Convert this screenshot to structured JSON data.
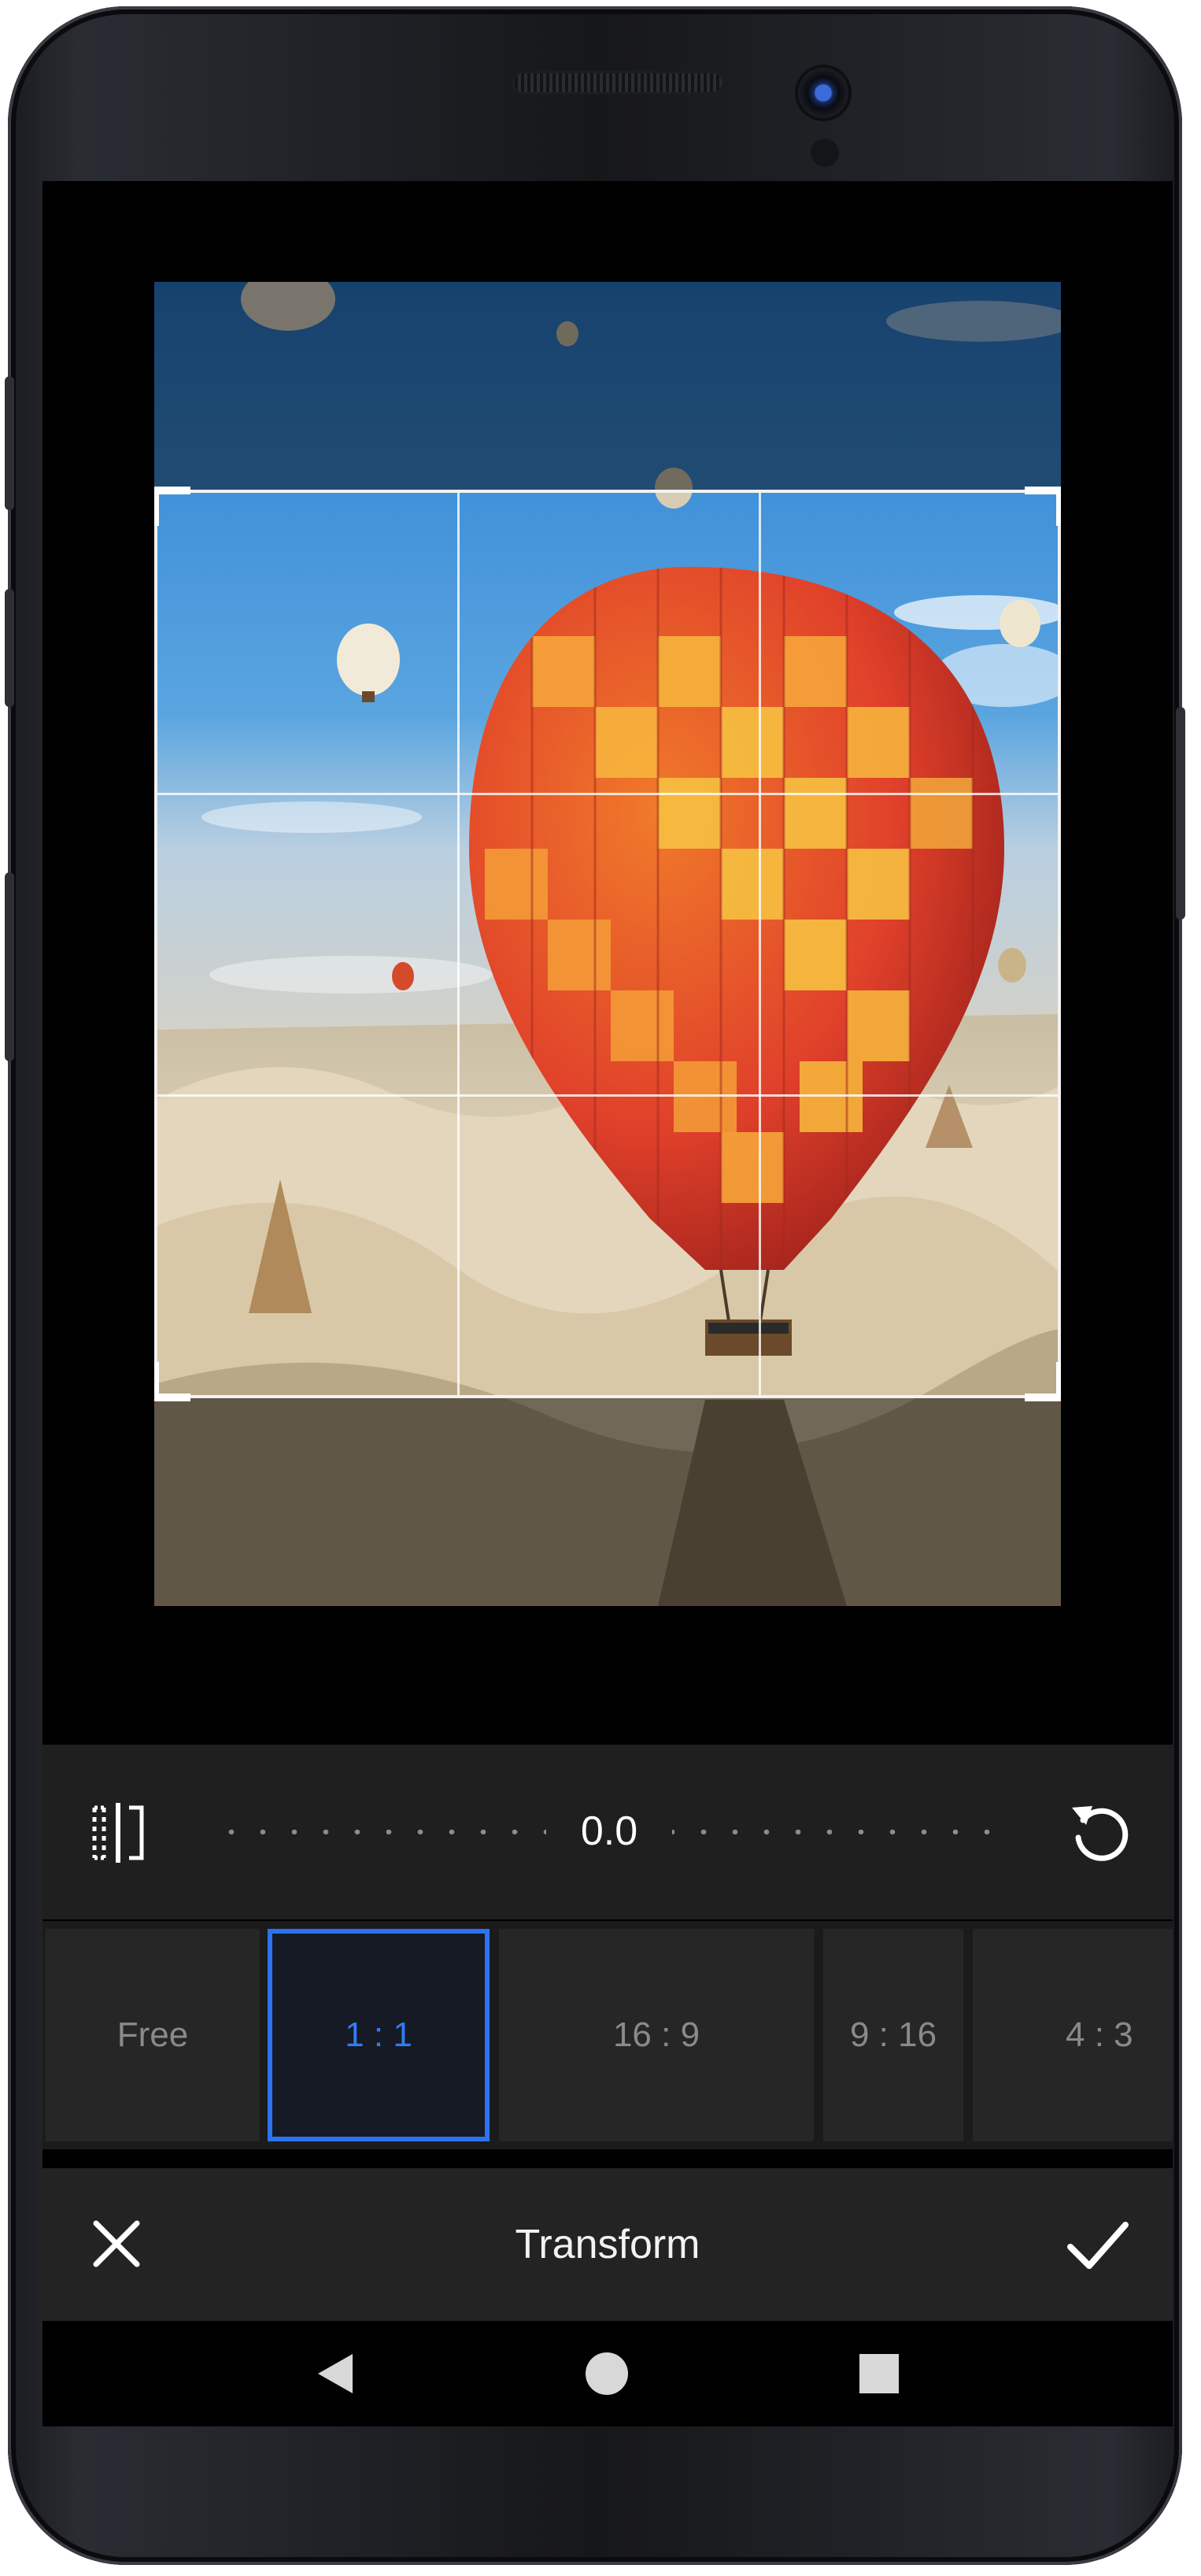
{
  "editor": {
    "rotation_value": "0.0",
    "mode_title": "Transform"
  },
  "aspect_ratios": [
    {
      "label": "Free",
      "selected": false
    },
    {
      "label": "1 : 1",
      "selected": true
    },
    {
      "label": "16 : 9",
      "selected": false
    },
    {
      "label": "9 : 16",
      "selected": false
    },
    {
      "label": "4 : 3",
      "selected": false
    }
  ],
  "icons": {
    "flip": "flip-icon",
    "reset_rotation": "reset-rotation-icon",
    "close": "close-icon",
    "confirm": "check-icon",
    "nav_back": "nav-back-icon",
    "nav_home": "nav-home-icon",
    "nav_recents": "nav-recents-icon"
  },
  "colors": {
    "accent": "#2b73f0",
    "toolbar_bg": "#1f1f1f",
    "action_bar_bg": "#232323",
    "inactive_text": "#8a8a8a"
  }
}
